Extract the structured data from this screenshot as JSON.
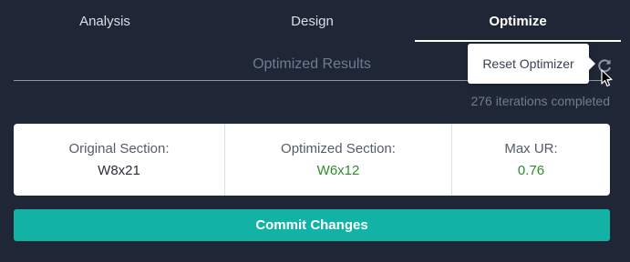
{
  "tabs": [
    {
      "label": "Analysis",
      "active": false
    },
    {
      "label": "Design",
      "active": false
    },
    {
      "label": "Optimize",
      "active": true
    }
  ],
  "section": {
    "title": "Optimized Results",
    "iterations_text": "276 iterations completed",
    "refresh_icon": "refresh-icon"
  },
  "tooltip": {
    "text": "Reset Optimizer"
  },
  "results": {
    "original": {
      "label": "Original Section:",
      "value": "W8x21"
    },
    "optimized": {
      "label": "Optimized Section:",
      "value": "W6x12"
    },
    "max_ur": {
      "label": "Max UR:",
      "value": "0.76"
    }
  },
  "commit_button": {
    "label": "Commit Changes"
  },
  "colors": {
    "background": "#1f2737",
    "accent": "#13b2a6",
    "positive": "#2e8b2e"
  }
}
